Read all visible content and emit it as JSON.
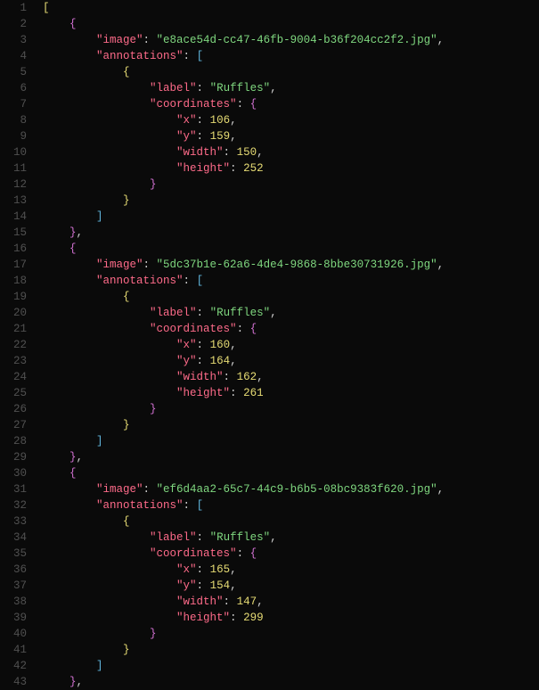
{
  "entries": [
    {
      "image_key": "image",
      "image_val": "e8ace54d-cc47-46fb-9004-b36f204cc2f2.jpg",
      "annotations_key": "annotations",
      "label_key": "label",
      "label_val": "Ruffles",
      "coordinates_key": "coordinates",
      "x_key": "x",
      "x_val": "106",
      "y_key": "y",
      "y_val": "159",
      "width_key": "width",
      "width_val": "150",
      "height_key": "height",
      "height_val": "252"
    },
    {
      "image_key": "image",
      "image_val": "5dc37b1e-62a6-4de4-9868-8bbe30731926.jpg",
      "annotations_key": "annotations",
      "label_key": "label",
      "label_val": "Ruffles",
      "coordinates_key": "coordinates",
      "x_key": "x",
      "x_val": "160",
      "y_key": "y",
      "y_val": "164",
      "width_key": "width",
      "width_val": "162",
      "height_key": "height",
      "height_val": "261"
    },
    {
      "image_key": "image",
      "image_val": "ef6d4aa2-65c7-44c9-b6b5-08bc9383f620.jpg",
      "annotations_key": "annotations",
      "label_key": "label",
      "label_val": "Ruffles",
      "coordinates_key": "coordinates",
      "x_key": "x",
      "x_val": "165",
      "y_key": "y",
      "y_val": "154",
      "width_key": "width",
      "width_val": "147",
      "height_key": "height",
      "height_val": "299"
    }
  ],
  "lineCount": 43
}
